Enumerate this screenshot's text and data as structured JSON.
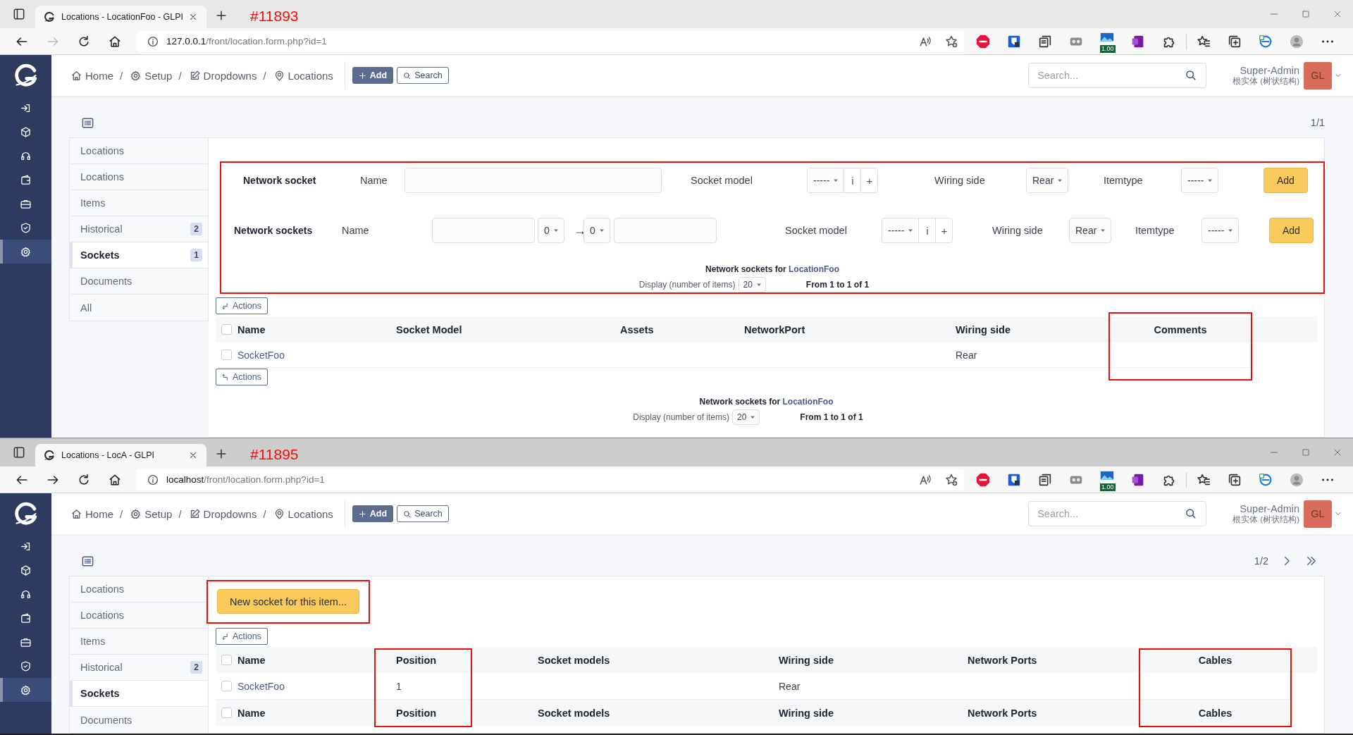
{
  "windows": [
    {
      "active": true,
      "annotation": "#11893",
      "tab": {
        "title": "Locations - LocationFoo - GLPI"
      },
      "nav": {
        "forward_disabled": true
      },
      "url": {
        "host": "127.0.0.1",
        "path": "/front/location.form.php?id=1"
      },
      "extension_badge": "1.00",
      "menu": [
        {
          "selected": false
        },
        {
          "selected": false
        },
        {
          "selected": false
        },
        {
          "selected": false
        },
        {
          "selected": false
        },
        {
          "selected": false
        },
        {
          "selected": true
        }
      ],
      "breadcrumb": [
        {
          "label": "Home",
          "separator": "/"
        },
        {
          "label": "Setup",
          "separator": "/"
        },
        {
          "label": "Dropdowns",
          "separator": "/"
        },
        {
          "label": "Locations"
        }
      ],
      "add_button": "Add",
      "search_button": "Search",
      "search": {
        "placeholder": "Search..."
      },
      "user": {
        "name": "Super-Admin",
        "entity": "根实体 (树状结构)",
        "initials": "GL"
      },
      "pager": {
        "text": "1/1",
        "more": false
      },
      "tabs": [
        {
          "label": "Locations",
          "selected": false
        },
        {
          "label": "Locations",
          "selected": false
        },
        {
          "label": "Items",
          "selected": false
        },
        {
          "label": "Historical",
          "count": "2",
          "selected": false
        },
        {
          "label": "Sockets",
          "count": "1",
          "selected": true
        },
        {
          "label": "Documents",
          "selected": false
        },
        {
          "label": "All",
          "selected": false
        }
      ],
      "blocks": [
        {
          "kind": "form",
          "annotated": true,
          "rows": [
            {
              "items": [
                {
                  "kind": "heading",
                  "text": "Network socket"
                },
                {
                  "kind": "label",
                  "text": "Name"
                },
                {
                  "kind": "input"
                },
                {
                  "kind": "label",
                  "text": "Socket model"
                },
                {
                  "kind": "model",
                  "value": "-----",
                  "info": "i",
                  "add": "+"
                },
                {
                  "kind": "label",
                  "text": "Wiring side"
                },
                {
                  "kind": "select",
                  "value": "Rear"
                },
                {
                  "kind": "label",
                  "text": "Itemtype"
                },
                {
                  "kind": "select",
                  "value": "-----"
                },
                {
                  "kind": "button",
                  "text": "Add"
                }
              ]
            },
            {
              "items": [
                {
                  "kind": "heading",
                  "text": "Network sockets"
                },
                {
                  "kind": "label",
                  "text": "Name"
                },
                {
                  "kind": "input"
                },
                {
                  "kind": "select",
                  "value": "0"
                },
                {
                  "kind": "arrow",
                  "text": "→"
                },
                {
                  "kind": "select",
                  "value": "0"
                },
                {
                  "kind": "input"
                },
                {
                  "kind": "label",
                  "text": "Socket model"
                },
                {
                  "kind": "model",
                  "value": "-----",
                  "info": "i",
                  "add": "+"
                },
                {
                  "kind": "label",
                  "text": "Wiring side"
                },
                {
                  "kind": "select",
                  "value": "Rear"
                },
                {
                  "kind": "label",
                  "text": "Itemtype"
                },
                {
                  "kind": "select",
                  "value": "-----"
                },
                {
                  "kind": "button",
                  "text": "Add"
                }
              ]
            }
          ],
          "listing": {
            "title": "Network sockets for",
            "link": "LocationFoo",
            "display_label": "Display (number of items)",
            "display_value": "20",
            "range": "From 1 to 1 of 1"
          }
        },
        {
          "kind": "actions",
          "label": "Actions",
          "points_up": false
        },
        {
          "kind": "table",
          "all_checked": false,
          "columns": [
            {
              "header": "Name",
              "kind": "link"
            },
            {
              "header": "Socket Model"
            },
            {
              "header": "Assets"
            },
            {
              "header": "NetworkPort"
            },
            {
              "header": "Wiring side"
            },
            {
              "header": "Comments",
              "annotated": true
            }
          ],
          "rows": [
            {
              "checked": false,
              "cells": [
                "SocketFoo",
                null,
                null,
                null,
                "Rear",
                null
              ]
            }
          ]
        },
        {
          "kind": "actions",
          "label": "Actions",
          "points_up": true
        },
        {
          "kind": "listing",
          "title": "Network sockets for",
          "link": "LocationFoo",
          "display_label": "Display (number of items)",
          "display_value": "20",
          "range": "From 1 to 1 of 1"
        }
      ]
    },
    {
      "active": false,
      "annotation": "#11895",
      "tab": {
        "title": "Locations - LocA - GLPI"
      },
      "nav": {
        "forward_disabled": false
      },
      "url": {
        "host": "localhost",
        "path": "/front/location.form.php?id=1"
      },
      "extension_badge": "1.00",
      "menu": [
        {
          "selected": false
        },
        {
          "selected": false
        },
        {
          "selected": false
        },
        {
          "selected": false
        },
        {
          "selected": false
        },
        {
          "selected": false
        },
        {
          "selected": true
        }
      ],
      "breadcrumb": [
        {
          "label": "Home",
          "separator": "/"
        },
        {
          "label": "Setup",
          "separator": "/"
        },
        {
          "label": "Dropdowns",
          "separator": "/"
        },
        {
          "label": "Locations"
        }
      ],
      "add_button": "Add",
      "search_button": "Search",
      "search": {
        "placeholder": "Search..."
      },
      "user": {
        "name": "Super-Admin",
        "entity": "根实体 (树状结构)",
        "initials": "GL"
      },
      "pager": {
        "text": "1/2",
        "more": true
      },
      "tabs": [
        {
          "label": "Locations",
          "selected": false
        },
        {
          "label": "Locations",
          "selected": false
        },
        {
          "label": "Items",
          "selected": false
        },
        {
          "label": "Historical",
          "count": "2",
          "selected": false
        },
        {
          "label": "Sockets",
          "selected": true
        },
        {
          "label": "Documents",
          "selected": false
        }
      ],
      "blocks": [
        {
          "kind": "new_button",
          "text": "New socket for this item...",
          "annotated": true
        },
        {
          "kind": "actions",
          "label": "Actions",
          "points_up": false
        },
        {
          "kind": "table",
          "all_checked": false,
          "footer_checked": false,
          "columns": [
            {
              "header": "Name",
              "footer": "Name",
              "kind": "link"
            },
            {
              "header": "Position",
              "footer": "Position",
              "annotated": true
            },
            {
              "header": "Socket models",
              "footer": "Socket models"
            },
            {
              "header": "Wiring side",
              "footer": "Wiring side"
            },
            {
              "header": "Network Ports",
              "footer": "Network Ports"
            },
            {
              "header": "Cables",
              "footer": "Cables",
              "annotated": true
            }
          ],
          "rows": [
            {
              "checked": false,
              "cells": [
                "SocketFoo",
                "1",
                null,
                "Rear",
                null,
                null
              ]
            }
          ]
        }
      ]
    }
  ]
}
